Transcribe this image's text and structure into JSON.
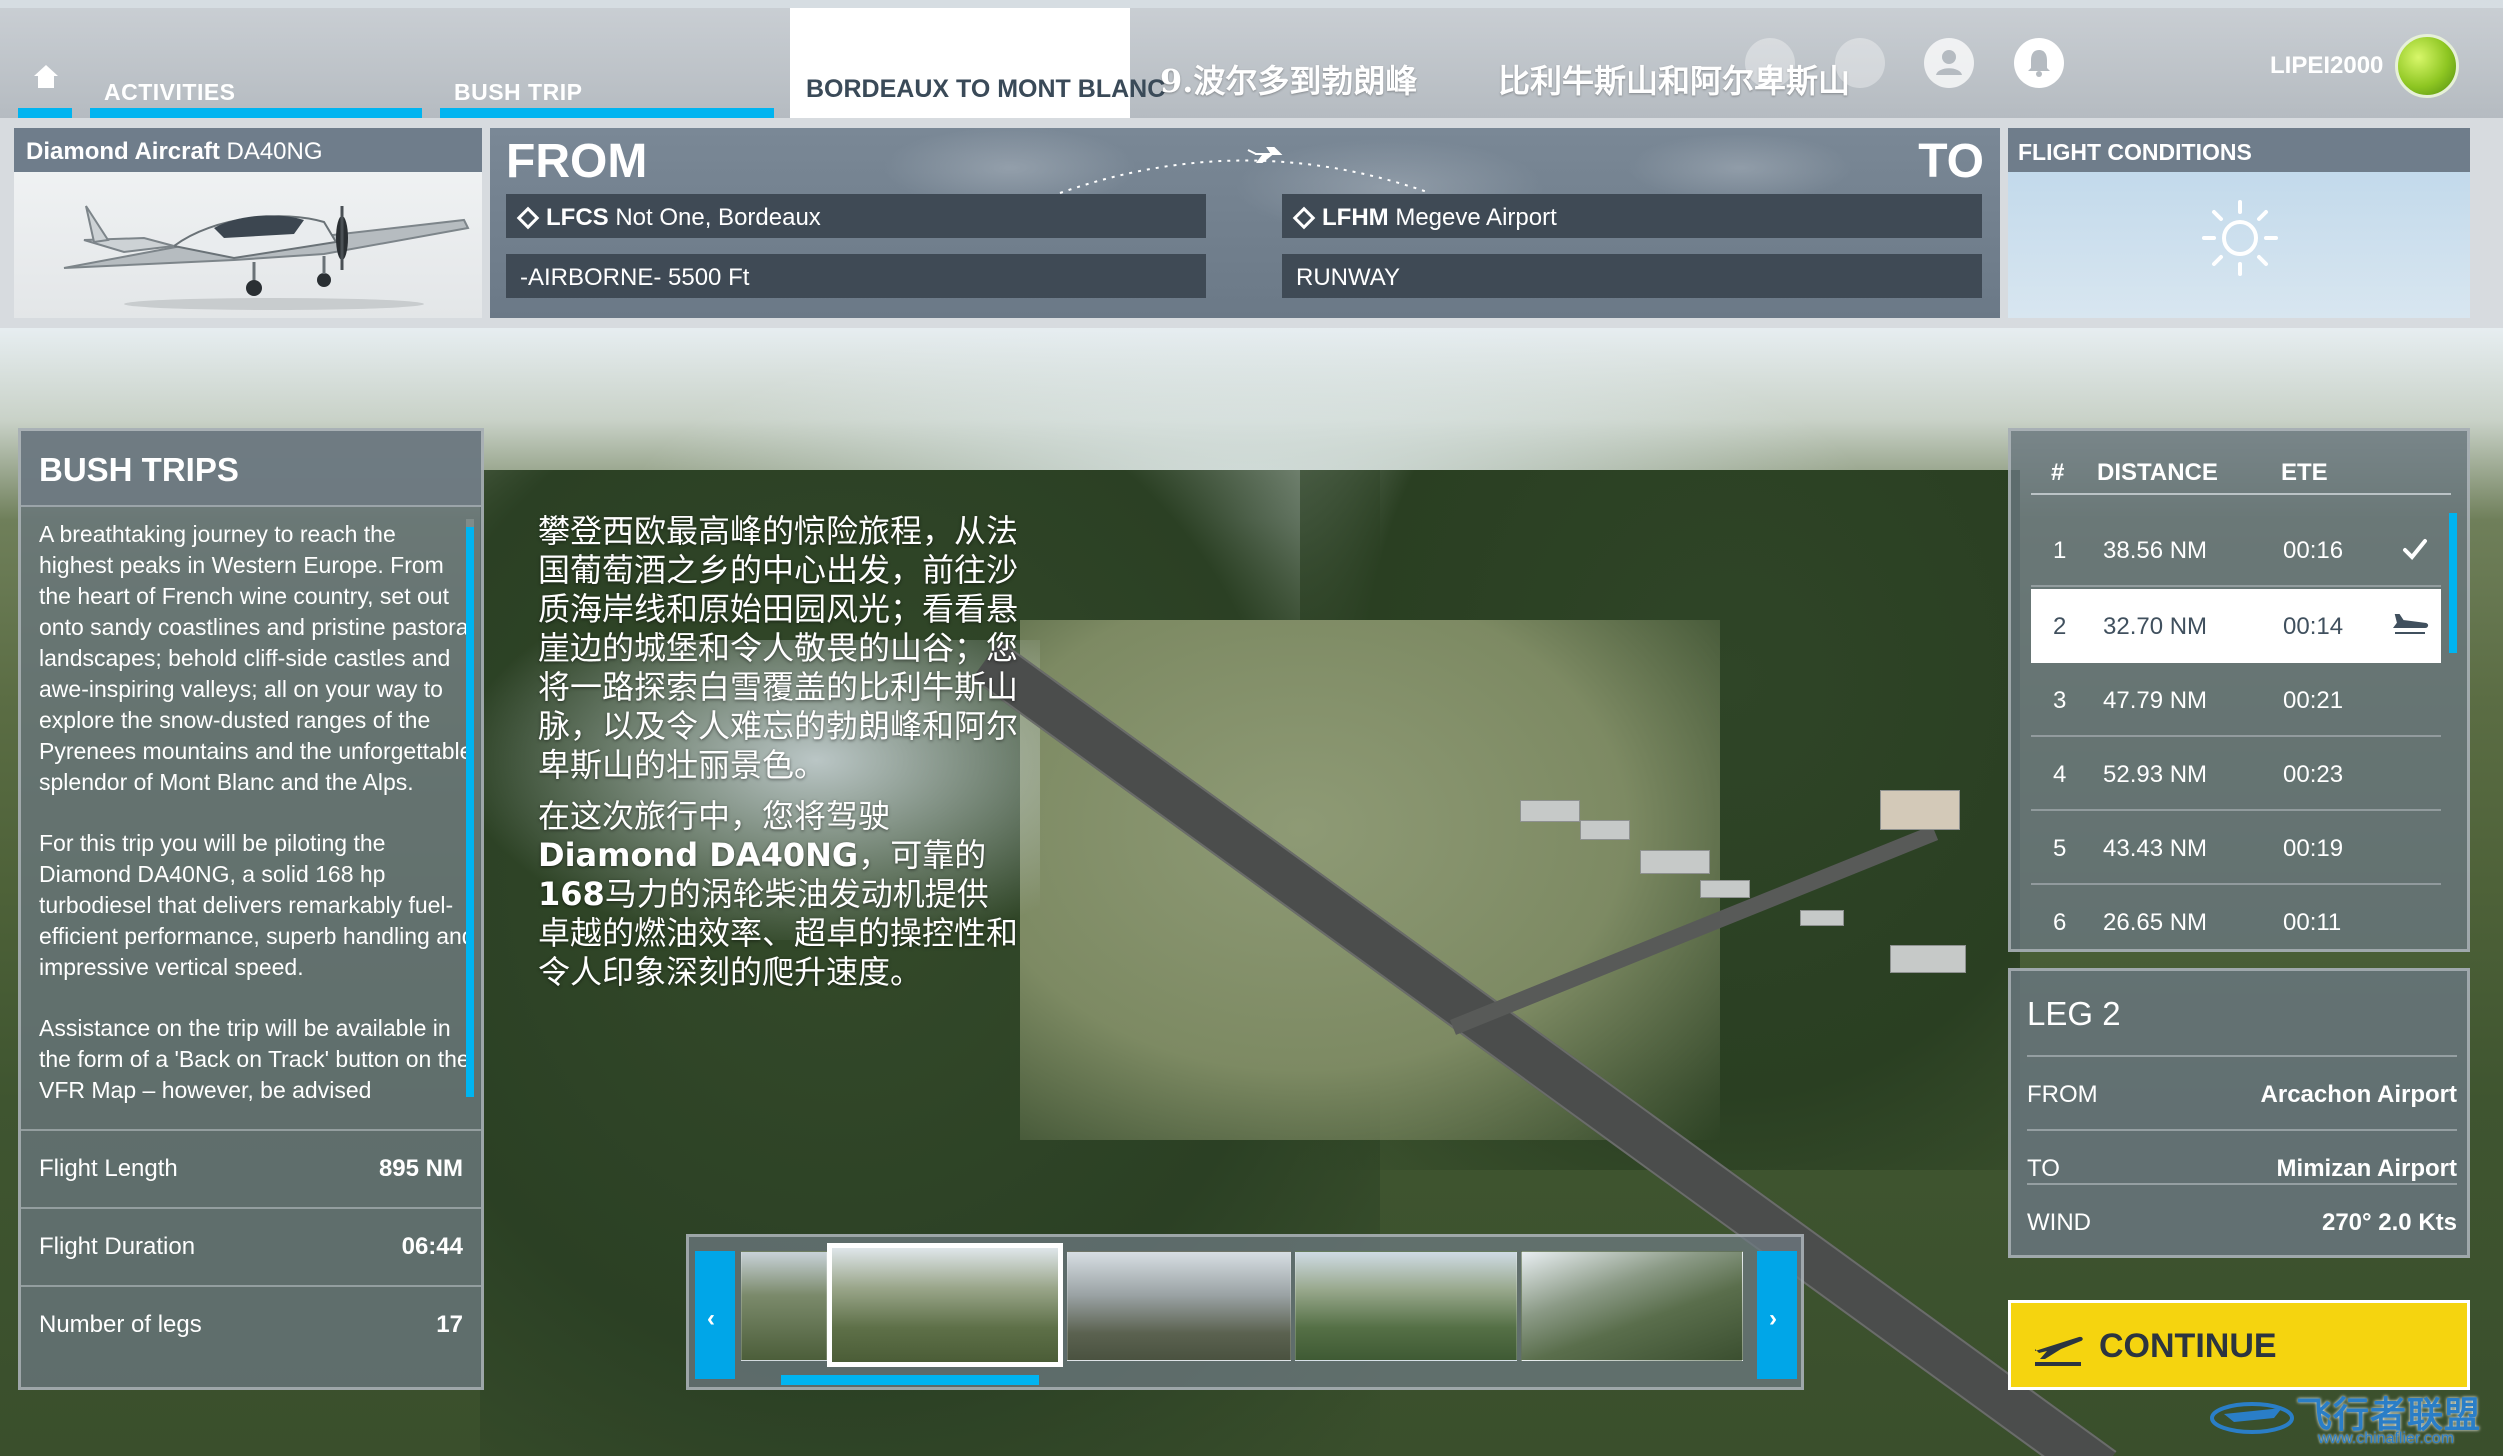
{
  "nav": {
    "activities": "ACTIVITIES",
    "bush_trip": "BUSH TRIP",
    "active_tab": "BORDEAUX TO MONT BLANC",
    "cn_subtitle_1": "9.波尔多到勃朗峰",
    "cn_subtitle_2": "比利牛斯山和阿尔卑斯山",
    "username": "LIPEI2000",
    "accent_color": "#00b4f0"
  },
  "aircraft": {
    "make": "Diamond Aircraft",
    "model": "DA40NG"
  },
  "route": {
    "from_label": "FROM",
    "to_label": "TO",
    "departure_code": "LFCS",
    "departure_name": "Not One, Bordeaux",
    "departure_start": "-AIRBORNE- 5500 Ft",
    "arrival_code": "LFHM",
    "arrival_name": "Megeve Airport",
    "arrival_start": "RUNWAY"
  },
  "conditions": {
    "title": "FLIGHT CONDITIONS",
    "weather_icon": "sun-icon"
  },
  "bush_trips": {
    "title": "BUSH TRIPS",
    "description": [
      "A breathtaking journey to reach the highest peaks in Western Europe. From the heart of French wine country, set out onto sandy coastlines and pristine pastoral landscapes; behold cliff-side castles and awe-inspiring valleys; all on your way to explore the snow-dusted ranges of the Pyrenees mountains and the unforgettable splendor of Mont Blanc and the Alps.",
      "For this trip you will be piloting the Diamond DA40NG, a solid 168 hp turbodiesel that delivers remarkably fuel-efficient performance, superb handling and impressive vertical speed.",
      "Assistance on the trip will be available in the form of a 'Back on Track' button on the VFR Map – however, be advised"
    ],
    "stats": [
      {
        "label": "Flight Length",
        "value": "895 NM"
      },
      {
        "label": "Flight Duration",
        "value": "06:44"
      },
      {
        "label": "Number of legs",
        "value": "17"
      }
    ]
  },
  "cn_overlay": {
    "para1": "攀登西欧最高峰的惊险旅程，从法国葡萄酒之乡的中心出发，前往沙质海岸线和原始田园风光；看看悬崖边的城堡和令人敬畏的山谷；您将一路探索白雪覆盖的比利牛斯山脉，以及令人难忘的勃朗峰和阿尔卑斯山的壮丽景色。",
    "para2_a": "在这次旅行中，您将驾驶",
    "para2_b": "Diamond DA40NG",
    "para2_c": "，可靠的",
    "para2_d": "168",
    "para2_e": "马力的涡轮柴油发动机提供卓越的燃油效率、超卓的操控性和令人印象深刻的爬升速度。"
  },
  "legs": {
    "headers": {
      "num": "#",
      "distance": "DISTANCE",
      "ete": "ETE"
    },
    "rows": [
      {
        "num": "1",
        "distance": "38.56 NM",
        "ete": "00:16",
        "status": "check-icon"
      },
      {
        "num": "2",
        "distance": "32.70 NM",
        "ete": "00:14",
        "status": "plane-icon"
      },
      {
        "num": "3",
        "distance": "47.79 NM",
        "ete": "00:21",
        "status": ""
      },
      {
        "num": "4",
        "distance": "52.93 NM",
        "ete": "00:23",
        "status": ""
      },
      {
        "num": "5",
        "distance": "43.43 NM",
        "ete": "00:19",
        "status": ""
      },
      {
        "num": "6",
        "distance": "26.65 NM",
        "ete": "00:11",
        "status": ""
      }
    ],
    "selected_index": 1
  },
  "leg_info": {
    "title": "LEG 2",
    "from_label": "FROM",
    "from_value": "Arcachon Airport",
    "to_label": "TO",
    "to_value": "Mimizan Airport",
    "wind_label": "WIND",
    "wind_value": "270° 2.0 Kts"
  },
  "continue_label": "CONTINUE",
  "continue_color": "#f5d40f",
  "watermark": {
    "text": "飞行者联盟",
    "url": "www.chinaflier.com"
  }
}
